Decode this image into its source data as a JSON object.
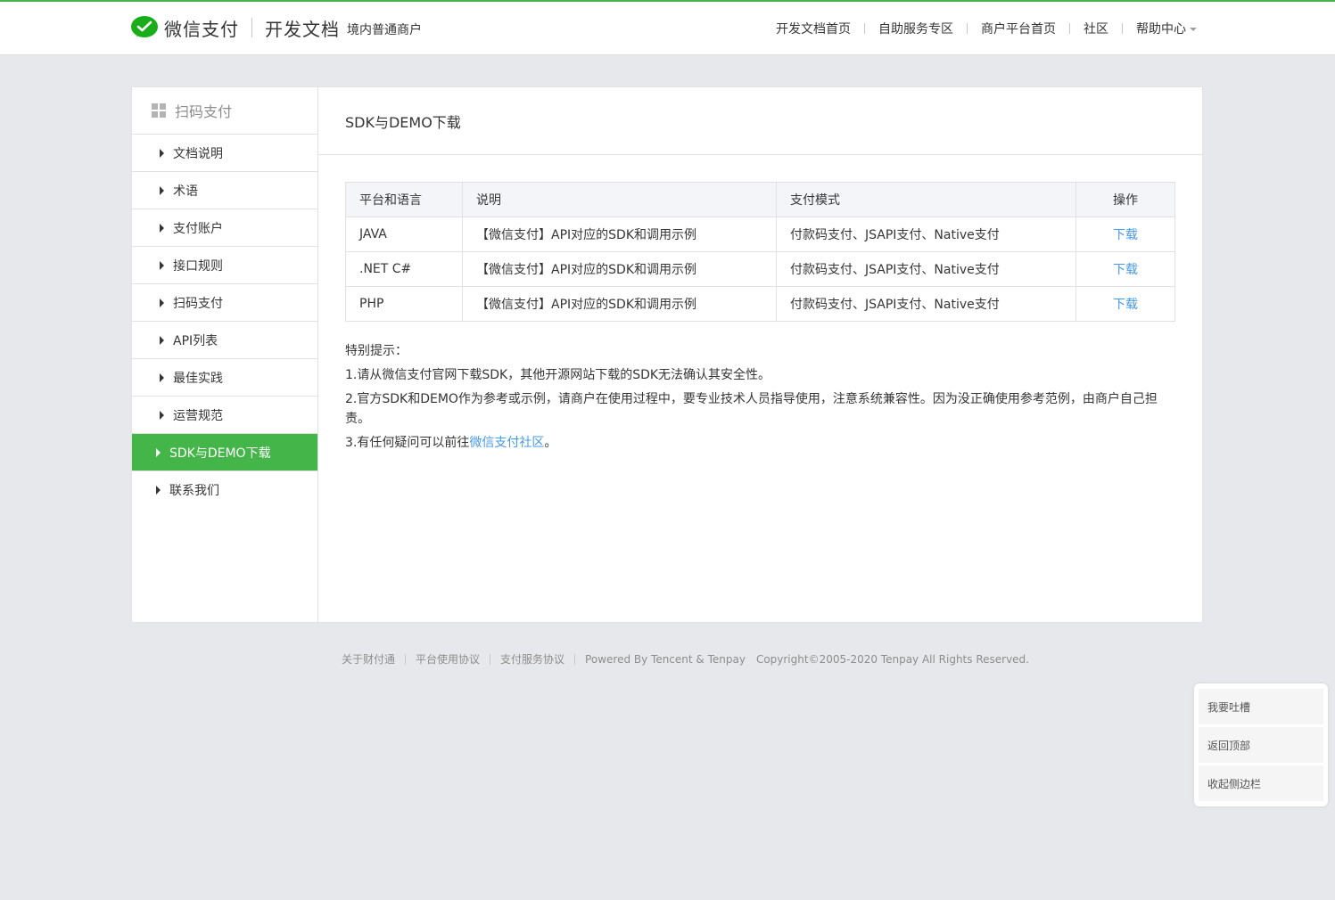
{
  "header": {
    "brand": "微信支付",
    "doc_title": "开发文档",
    "doc_subtitle": "境内普通商户",
    "nav": [
      {
        "label": "开发文档首页"
      },
      {
        "label": "自助服务专区"
      },
      {
        "label": "商户平台首页"
      },
      {
        "label": "社区"
      },
      {
        "label": "帮助中心"
      }
    ]
  },
  "sidebar": {
    "title": "扫码支付",
    "items": [
      {
        "label": "文档说明"
      },
      {
        "label": "术语"
      },
      {
        "label": "支付账户"
      },
      {
        "label": "接口规则"
      },
      {
        "label": "扫码支付"
      },
      {
        "label": "API列表"
      },
      {
        "label": "最佳实践"
      },
      {
        "label": "运营规范"
      },
      {
        "label": "SDK与DEMO下载",
        "active": true
      },
      {
        "label": "联系我们"
      }
    ]
  },
  "main": {
    "title": "SDK与DEMO下载",
    "table": {
      "headers": [
        "平台和语言",
        "说明",
        "支付模式",
        "操作"
      ],
      "rows": [
        [
          "JAVA",
          "【微信支付】API对应的SDK和调用示例",
          "付款码支付、JSAPI支付、Native支付",
          "下载"
        ],
        [
          ".NET C#",
          "【微信支付】API对应的SDK和调用示例",
          "付款码支付、JSAPI支付、Native支付",
          "下载"
        ],
        [
          "PHP",
          "【微信支付】API对应的SDK和调用示例",
          "付款码支付、JSAPI支付、Native支付",
          "下载"
        ]
      ]
    },
    "notes": {
      "heading": "特别提示：",
      "line1": "1.请从微信支付官网下载SDK，其他开源网站下载的SDK无法确认其安全性。",
      "line2": "2.官方SDK和DEMO作为参考或示例，请商户在使用过程中，要专业技术人员指导使用，注意系统兼容性。因为没正确使用参考范例，由商户自己担责。",
      "line3_prefix": "3.有任何疑问可以前往",
      "line3_link": "微信支付社区",
      "line3_suffix": "。"
    }
  },
  "footer": {
    "links": [
      "关于财付通",
      "平台使用协议",
      "支付服务协议"
    ],
    "powered": "Powered By Tencent & Tenpay",
    "copyright": "Copyright©2005-2020 Tenpay All Rights Reserved."
  },
  "floatbar": {
    "items": [
      "我要吐槽",
      "返回顶部",
      "收起侧边栏"
    ]
  },
  "colors": {
    "accent": "#44b549",
    "link": "#459ae9"
  }
}
